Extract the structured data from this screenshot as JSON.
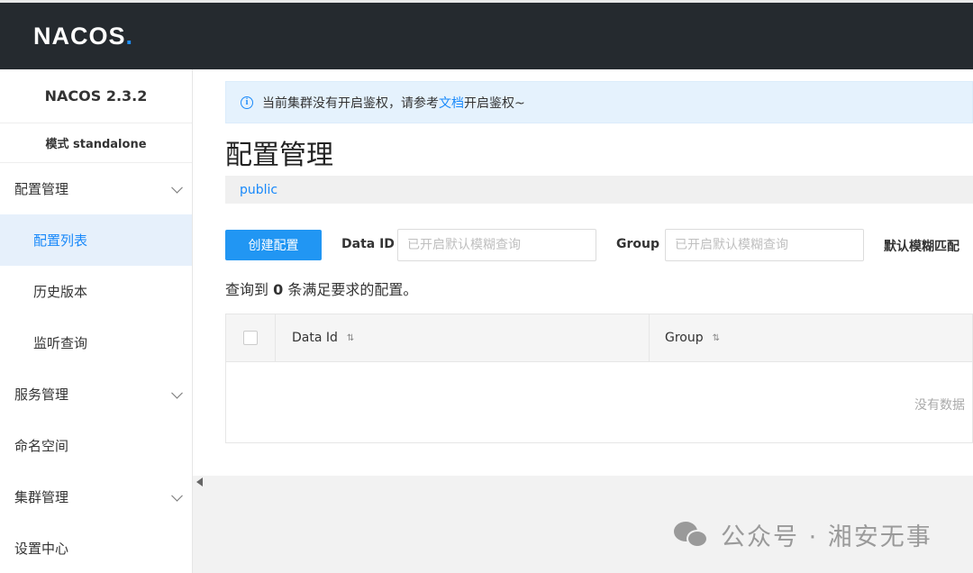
{
  "header": {
    "logo_main": "NACOS",
    "logo_dot": "."
  },
  "sidebar": {
    "version": "NACOS 2.3.2",
    "mode": "模式 standalone",
    "items": [
      {
        "label": "配置管理"
      },
      {
        "label": "配置列表"
      },
      {
        "label": "历史版本"
      },
      {
        "label": "监听查询"
      },
      {
        "label": "服务管理"
      },
      {
        "label": "命名空间"
      },
      {
        "label": "集群管理"
      },
      {
        "label": "设置中心"
      }
    ]
  },
  "notice": {
    "text_before": "当前集群没有开启鉴权，请参考",
    "link": "文档",
    "text_after": "开启鉴权~"
  },
  "page": {
    "title": "配置管理",
    "namespace": "public"
  },
  "toolbar": {
    "create_label": "创建配置",
    "dataid_label": "Data ID",
    "dataid_placeholder": "已开启默认模糊查询",
    "group_label": "Group",
    "group_placeholder": "已开启默认模糊查询",
    "fuzzy_label": "默认模糊匹配"
  },
  "result": {
    "prefix": "查询到 ",
    "count": "0",
    "suffix": " 条满足要求的配置。"
  },
  "table": {
    "columns": [
      "Data Id",
      "Group"
    ],
    "empty_text": "没有数据"
  },
  "watermark": {
    "text": "公众号 · 湘安无事"
  }
}
